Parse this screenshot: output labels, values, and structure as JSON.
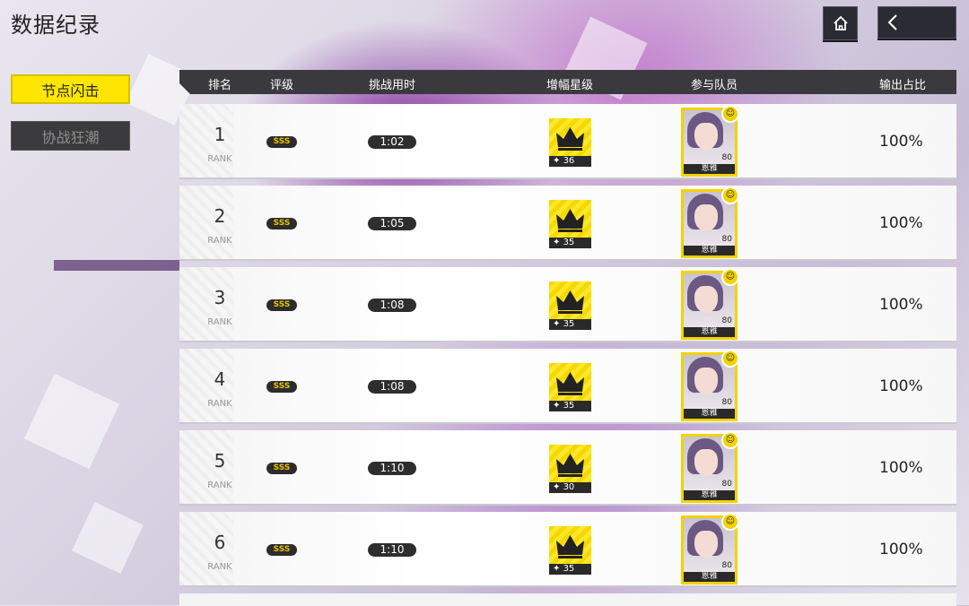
{
  "page": {
    "title": "数据纪录"
  },
  "top_buttons": {
    "home_icon": "home-icon",
    "back_icon": "back-arrow-icon"
  },
  "sidebar": {
    "tabs": [
      {
        "label": "节点闪击",
        "active": true
      },
      {
        "label": "协战狂潮",
        "active": false
      }
    ]
  },
  "table": {
    "headers": [
      "排名",
      "评级",
      "挑战用时",
      "增幅星级",
      "参与队员",
      "输出占比"
    ],
    "rank_label": "RANK",
    "rows": [
      {
        "rank": "1",
        "grade": "SSS",
        "time": "1:02",
        "boost": "36",
        "member_level": "80",
        "member_name": "恩雅",
        "output": "100%"
      },
      {
        "rank": "2",
        "grade": "SSS",
        "time": "1:05",
        "boost": "35",
        "member_level": "80",
        "member_name": "恩雅",
        "output": "100%"
      },
      {
        "rank": "3",
        "grade": "SSS",
        "time": "1:08",
        "boost": "35",
        "member_level": "80",
        "member_name": "恩雅",
        "output": "100%"
      },
      {
        "rank": "4",
        "grade": "SSS",
        "time": "1:08",
        "boost": "35",
        "member_level": "80",
        "member_name": "恩雅",
        "output": "100%"
      },
      {
        "rank": "5",
        "grade": "SSS",
        "time": "1:10",
        "boost": "30",
        "member_level": "80",
        "member_name": "恩雅",
        "output": "100%"
      },
      {
        "rank": "6",
        "grade": "SSS",
        "time": "1:10",
        "boost": "35",
        "member_level": "80",
        "member_name": "恩雅",
        "output": "100%"
      }
    ]
  },
  "colors": {
    "accent_yellow": "#ffe600",
    "dark": "#2b2b33"
  }
}
